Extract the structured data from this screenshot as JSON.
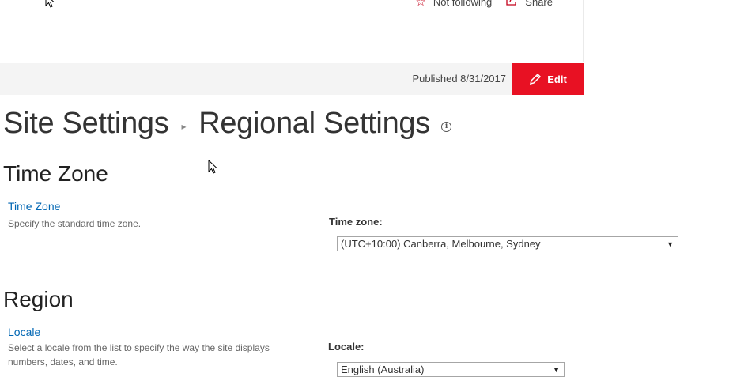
{
  "header": {
    "follow_label": "Not following",
    "share_label": "Share",
    "follow_icon": "star-icon",
    "share_icon": "share-icon"
  },
  "status_bar": {
    "published_text": "Published 8/31/2017",
    "edit_label": "Edit",
    "edit_color": "#e81123"
  },
  "breadcrumb": {
    "parent": "Site Settings",
    "separator": "›",
    "current": "Regional Settings",
    "info_icon": "info-icon"
  },
  "time_zone_section": {
    "heading": "Time Zone",
    "link": "Time Zone",
    "description": "Specify the standard time zone.",
    "field_label": "Time zone:",
    "selected_value": "(UTC+10:00) Canberra, Melbourne, Sydney"
  },
  "region_section": {
    "heading": "Region",
    "link": "Locale",
    "description": "Select a locale from the list to specify the way the site displays numbers, dates, and time.",
    "field_label": "Locale:",
    "selected_value": "English (Australia)"
  },
  "colors": {
    "accent_red": "#e81123",
    "link_blue": "#0066b3"
  }
}
